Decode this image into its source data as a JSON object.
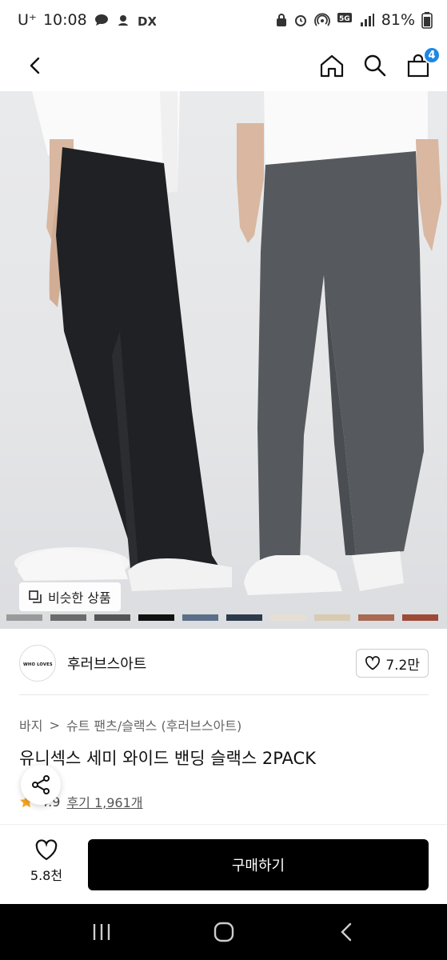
{
  "status_bar": {
    "carrier": "U⁺",
    "time": "10:08",
    "battery": "81%"
  },
  "header": {
    "cart_count": "4"
  },
  "hero": {
    "similar_label": "비슷한 상품",
    "swatches": [
      "#9a9a9a",
      "#6b6b6b",
      "#555555",
      "#111111",
      "#5b7088",
      "#2d3a4c",
      "#e6dfd5",
      "#d8cbb2",
      "#a86a52",
      "#9c4a36"
    ]
  },
  "brand": {
    "logo_text": "WHO LOVES ART",
    "name": "후러브스아트",
    "likes": "7.2만"
  },
  "breadcrumb": {
    "cat1": "바지",
    "sep": ">",
    "cat2": "슈트 팬츠/슬랙스 (후러브스아트)"
  },
  "product": {
    "title": "유니섹스 세미 와이드 밴딩 슬랙스 2PACK",
    "rating": "4.9",
    "reviews": "후기 1,961개"
  },
  "bottom": {
    "wish_count": "5.8천",
    "buy_label": "구매하기"
  },
  "colors": {
    "accent": "#1e88e5",
    "buy_bg": "#000000",
    "star": "#f5a623"
  }
}
